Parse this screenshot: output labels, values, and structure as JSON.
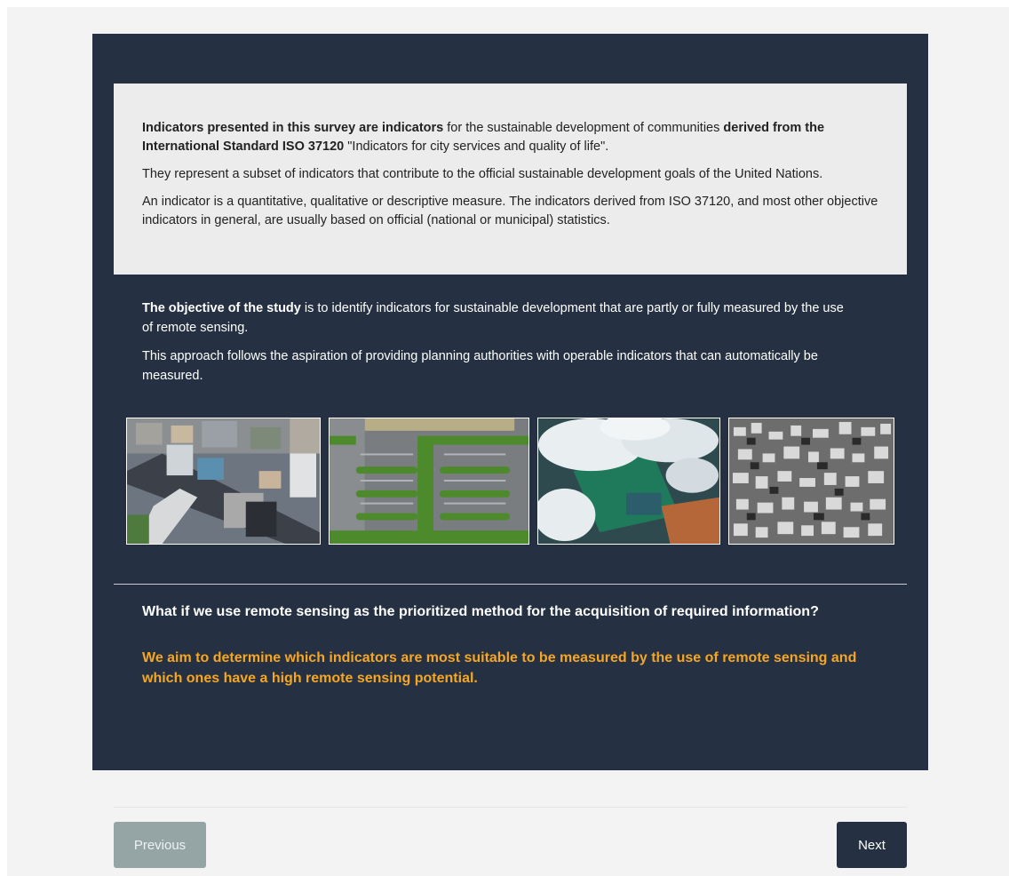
{
  "info": {
    "p1_bold1": "Indicators presented in this survey are indicators",
    "p1_text1": " for the sustainable development of communities ",
    "p1_bold2": "derived from the International Standard ISO 37120",
    "p1_text2": " \"Indicators for city services and quality of life\".",
    "p2": "They represent a subset of indicators that contribute to the official sustainable development goals of the United Nations.",
    "p3": "An indicator is a quantitative, qualitative or descriptive measure. The indicators derived from ISO 37120, and most other objective indicators in general, are usually based on official (national or municipal) statistics."
  },
  "objective": {
    "bold": "The objective of the study",
    "text": " is to identify indicators for sustainable development that are partly or fully measured by the use of remote sensing.",
    "p2": "This approach follows the aspiration of providing planning authorities with operable indicators that can automatically be measured."
  },
  "images": [
    "aerial-city-street-image",
    "parking-lot-trees-image",
    "clouds-over-city-image",
    "dense-settlement-image"
  ],
  "question": "What if we use remote sensing as the prioritized method for the acquisition of required information?",
  "aim": "We aim to determine which indicators are most suitable to be measured by the use of remote sensing and which ones have a high remote sensing potential.",
  "colors": {
    "panel": "#253142",
    "accent": "#f5a623",
    "info_bg": "#ececec",
    "prev_button": "#95a5a6"
  },
  "nav": {
    "previous": "Previous",
    "next": "Next"
  }
}
